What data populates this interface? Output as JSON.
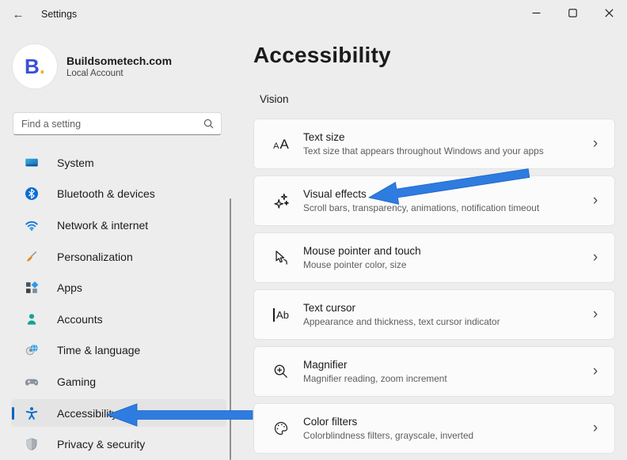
{
  "titlebar": {
    "title": "Settings",
    "back_icon": "back-arrow-icon",
    "controls": [
      {
        "name": "minimize-button",
        "icon": "minimize-icon"
      },
      {
        "name": "maximize-button",
        "icon": "maximize-icon"
      },
      {
        "name": "close-button",
        "icon": "close-icon"
      }
    ]
  },
  "account": {
    "name": "Buildsometech.com",
    "type": "Local Account",
    "avatar_text": "B",
    "avatar_dot": "."
  },
  "search": {
    "placeholder": "Find a setting",
    "icon": "search-icon"
  },
  "sidebar": {
    "items": [
      {
        "label": "System",
        "icon": "system-icon",
        "selected": false
      },
      {
        "label": "Bluetooth & devices",
        "icon": "bluetooth-icon",
        "selected": false
      },
      {
        "label": "Network & internet",
        "icon": "network-icon",
        "selected": false
      },
      {
        "label": "Personalization",
        "icon": "personalization-icon",
        "selected": false
      },
      {
        "label": "Apps",
        "icon": "apps-icon",
        "selected": false
      },
      {
        "label": "Accounts",
        "icon": "accounts-icon",
        "selected": false
      },
      {
        "label": "Time & language",
        "icon": "time-language-icon",
        "selected": false
      },
      {
        "label": "Gaming",
        "icon": "gaming-icon",
        "selected": false
      },
      {
        "label": "Accessibility",
        "icon": "accessibility-icon",
        "selected": true
      },
      {
        "label": "Privacy & security",
        "icon": "privacy-security-icon",
        "selected": false
      }
    ]
  },
  "main": {
    "title": "Accessibility",
    "section_label": "Vision",
    "cards": [
      {
        "title": "Text size",
        "subtitle": "Text size that appears throughout Windows and your apps",
        "icon": "text-size-icon",
        "chevron": "chevron-right-icon"
      },
      {
        "title": "Visual effects",
        "subtitle": "Scroll bars, transparency, animations, notification timeout",
        "icon": "visual-effects-icon",
        "chevron": "chevron-right-icon"
      },
      {
        "title": "Mouse pointer and touch",
        "subtitle": "Mouse pointer color, size",
        "icon": "mouse-pointer-icon",
        "chevron": "chevron-right-icon"
      },
      {
        "title": "Text cursor",
        "subtitle": "Appearance and thickness, text cursor indicator",
        "icon": "text-cursor-icon",
        "chevron": "chevron-right-icon"
      },
      {
        "title": "Magnifier",
        "subtitle": "Magnifier reading, zoom increment",
        "icon": "magnifier-icon",
        "chevron": "chevron-right-icon"
      },
      {
        "title": "Color filters",
        "subtitle": "Colorblindness filters, grayscale, inverted",
        "icon": "color-filters-icon",
        "chevron": "chevron-right-icon"
      }
    ]
  },
  "annotations": {
    "arrows": [
      {
        "name": "arrow-pointing-to-visual-effects",
        "target": "Visual effects"
      },
      {
        "name": "arrow-pointing-to-accessibility",
        "target": "Accessibility"
      }
    ]
  },
  "colors": {
    "accent": "#0067c0",
    "arrow": "#2e7ce0",
    "app_bg": "#ededed",
    "card_bg": "#fbfbfb",
    "card_border": "#e3e3e3",
    "selected_bg": "#e4e4e4",
    "text_primary": "#1b1b1b",
    "text_secondary": "#5d5d5d"
  }
}
